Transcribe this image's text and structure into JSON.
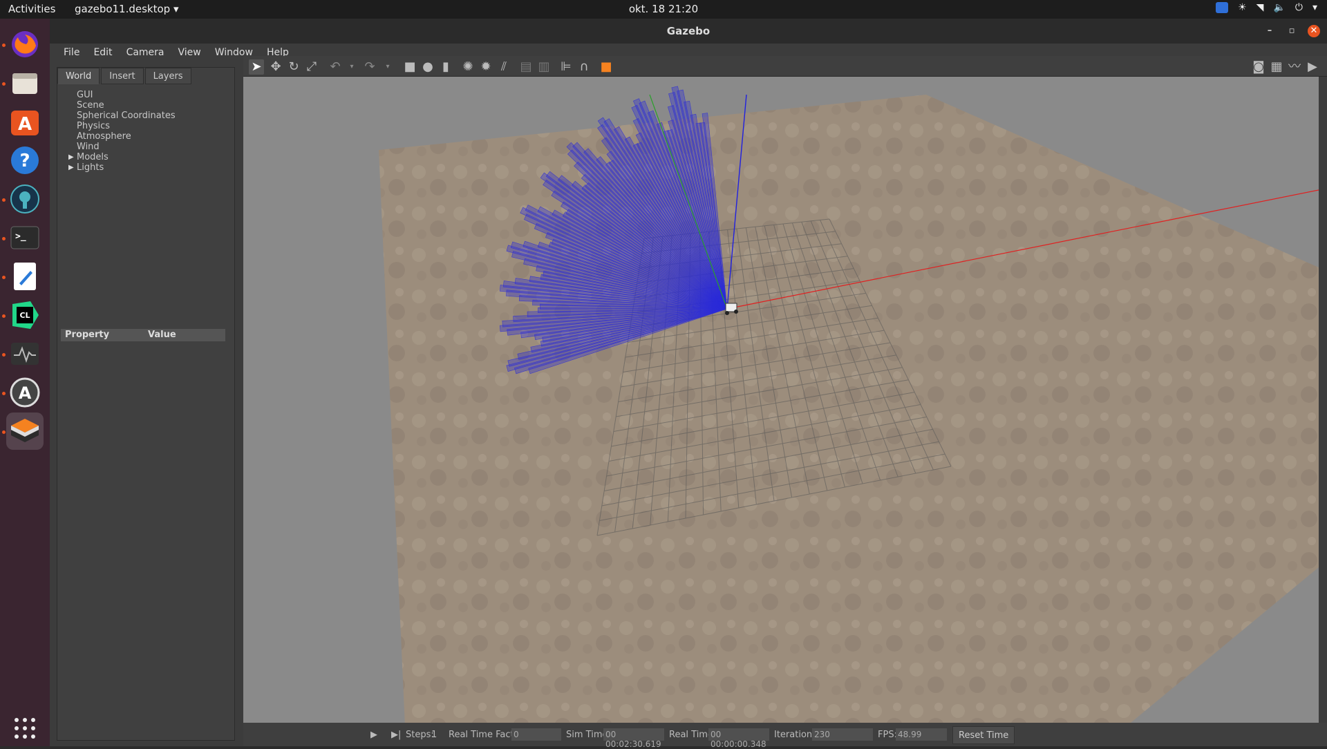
{
  "topbar": {
    "activities": "Activities",
    "app_menu": "gazebo11.desktop",
    "clock": "okt. 18  21:20"
  },
  "dock": {
    "items": [
      {
        "name": "firefox-icon",
        "color": "#e66000"
      },
      {
        "name": "files-icon",
        "color": "#7f7f7f"
      },
      {
        "name": "software-center-icon",
        "color": "#e95420"
      },
      {
        "name": "help-icon",
        "color": "#2a7ad8"
      },
      {
        "name": "gitkraken-icon",
        "color": "#1a3a4a"
      },
      {
        "name": "terminal-icon",
        "color": "#2b2b2b"
      },
      {
        "name": "text-editor-icon",
        "color": "#ffffff"
      },
      {
        "name": "clion-icon",
        "color": "#21d789"
      },
      {
        "name": "system-monitor-icon",
        "color": "#333333"
      },
      {
        "name": "software-updater-icon",
        "color": "#333333"
      },
      {
        "name": "gazebo-icon",
        "color": "#f58220"
      }
    ]
  },
  "window": {
    "title": "Gazebo",
    "menu": [
      "File",
      "Edit",
      "Camera",
      "View",
      "Window",
      "Help"
    ]
  },
  "left_panel": {
    "tabs": [
      "World",
      "Insert",
      "Layers"
    ],
    "tree": [
      "GUI",
      "Scene",
      "Spherical Coordinates",
      "Physics",
      "Atmosphere",
      "Wind",
      "Models",
      "Lights"
    ],
    "property_header": "Property",
    "value_header": "Value"
  },
  "bottom_bar": {
    "steps_label": "Steps:",
    "steps_value": "1",
    "rtf_label": "Real Time Factor:",
    "rtf_value": "0",
    "sim_time_label": "Sim Time:",
    "sim_time_value": "00 00:02:30.619",
    "real_time_label": "Real Time:",
    "real_time_value": "00 00:00:00.348",
    "iterations_label": "Iterations:",
    "iterations_value": "230",
    "fps_label": "FPS:",
    "fps_value": "48.99",
    "reset_label": "Reset Time"
  },
  "colors": {
    "laser": "#2a2ad8",
    "ground": "#9e8f7d",
    "axis_x": "#e02020",
    "axis_y": "#2aa02a",
    "axis_z": "#2020e0"
  }
}
